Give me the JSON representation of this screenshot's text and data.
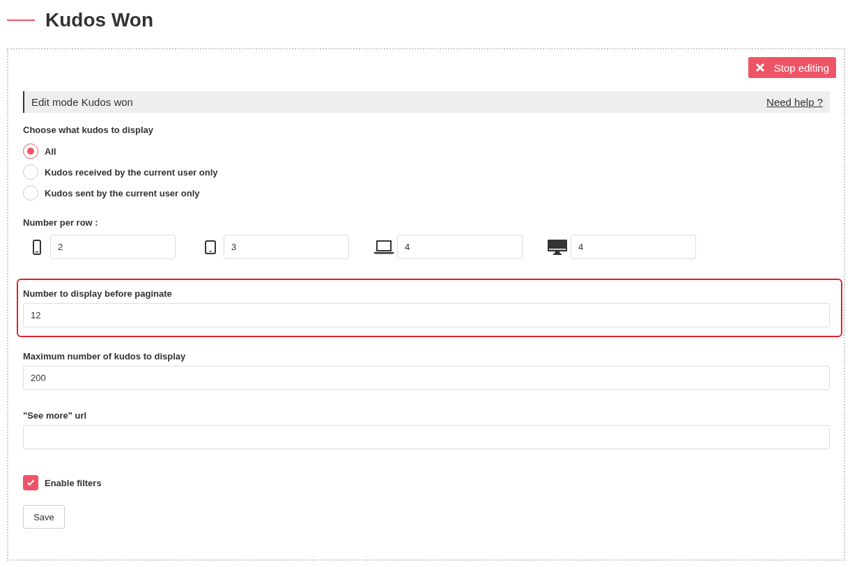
{
  "header": {
    "title": "Kudos Won"
  },
  "stop_button": {
    "label": "Stop editing"
  },
  "edit_bar": {
    "title": "Edit mode Kudos won",
    "help_link": "Need help ?"
  },
  "display_choice": {
    "label": "Choose what kudos to display",
    "options": [
      {
        "label": "All",
        "selected": true
      },
      {
        "label": "Kudos received by the current user only",
        "selected": false
      },
      {
        "label": "Kudos sent by the current user only",
        "selected": false
      }
    ]
  },
  "per_row": {
    "label": "Number per row :",
    "devices": [
      {
        "kind": "phone",
        "value": "2"
      },
      {
        "kind": "tablet",
        "value": "3"
      },
      {
        "kind": "laptop",
        "value": "4"
      },
      {
        "kind": "desktop",
        "value": "4"
      }
    ]
  },
  "fields": [
    {
      "label": "Number to display before paginate",
      "value": "12",
      "highlighted": true
    },
    {
      "label": "Maximum number of kudos to display",
      "value": "200",
      "highlighted": false
    },
    {
      "label": "\"See more\" url",
      "highlighted": false
    }
  ],
  "enable_filters": {
    "label": "Enable filters",
    "checked": true
  },
  "save_button": {
    "label": "Save"
  }
}
